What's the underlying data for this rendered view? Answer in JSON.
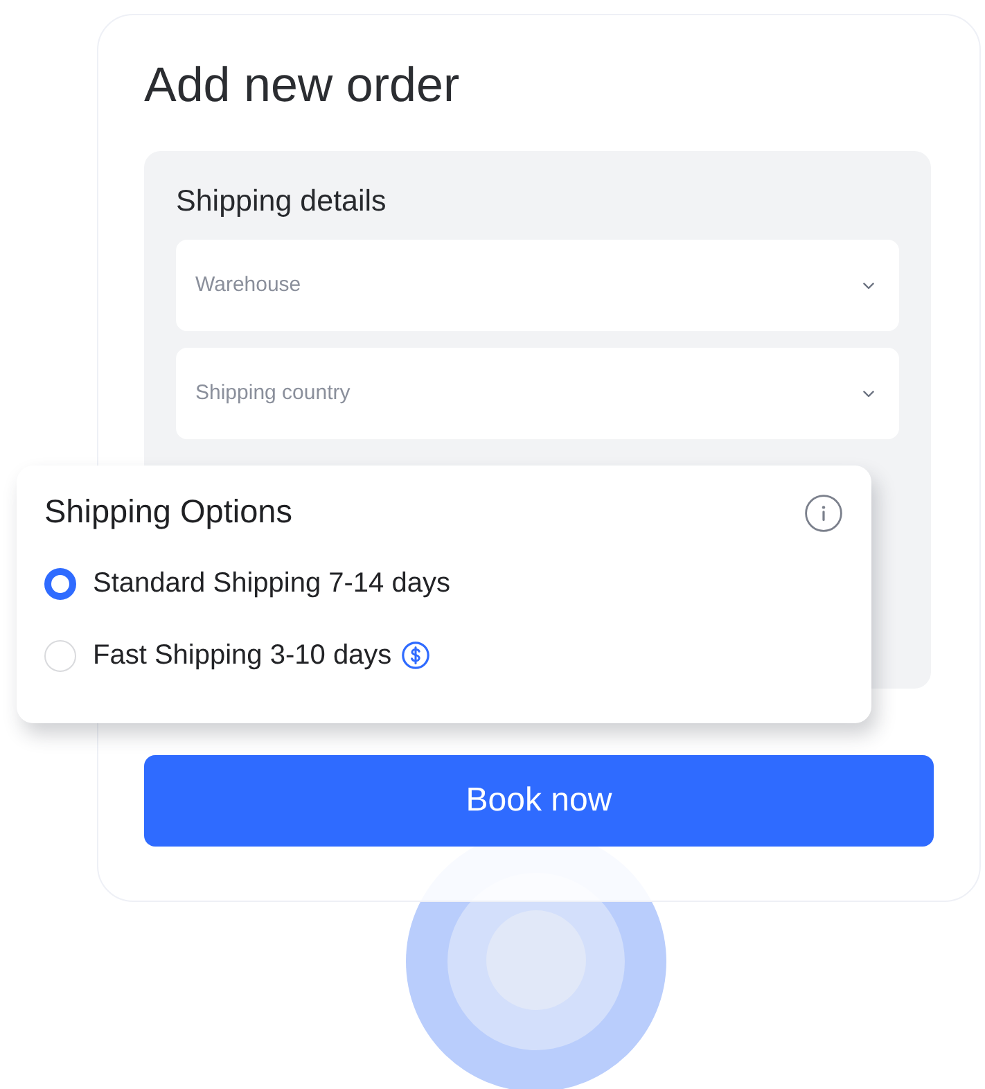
{
  "page": {
    "title": "Add new order"
  },
  "shipping_details": {
    "title": "Shipping details",
    "fields": [
      {
        "placeholder": "Warehouse"
      },
      {
        "placeholder": "Shipping country"
      }
    ]
  },
  "shipping_options": {
    "title": "Shipping Options",
    "options": [
      {
        "label": "Standard Shipping 7-14 days",
        "selected": true,
        "paid": false
      },
      {
        "label": "Fast Shipping 3-10 days",
        "selected": false,
        "paid": true
      }
    ]
  },
  "book_button": {
    "label": "Book now"
  }
}
